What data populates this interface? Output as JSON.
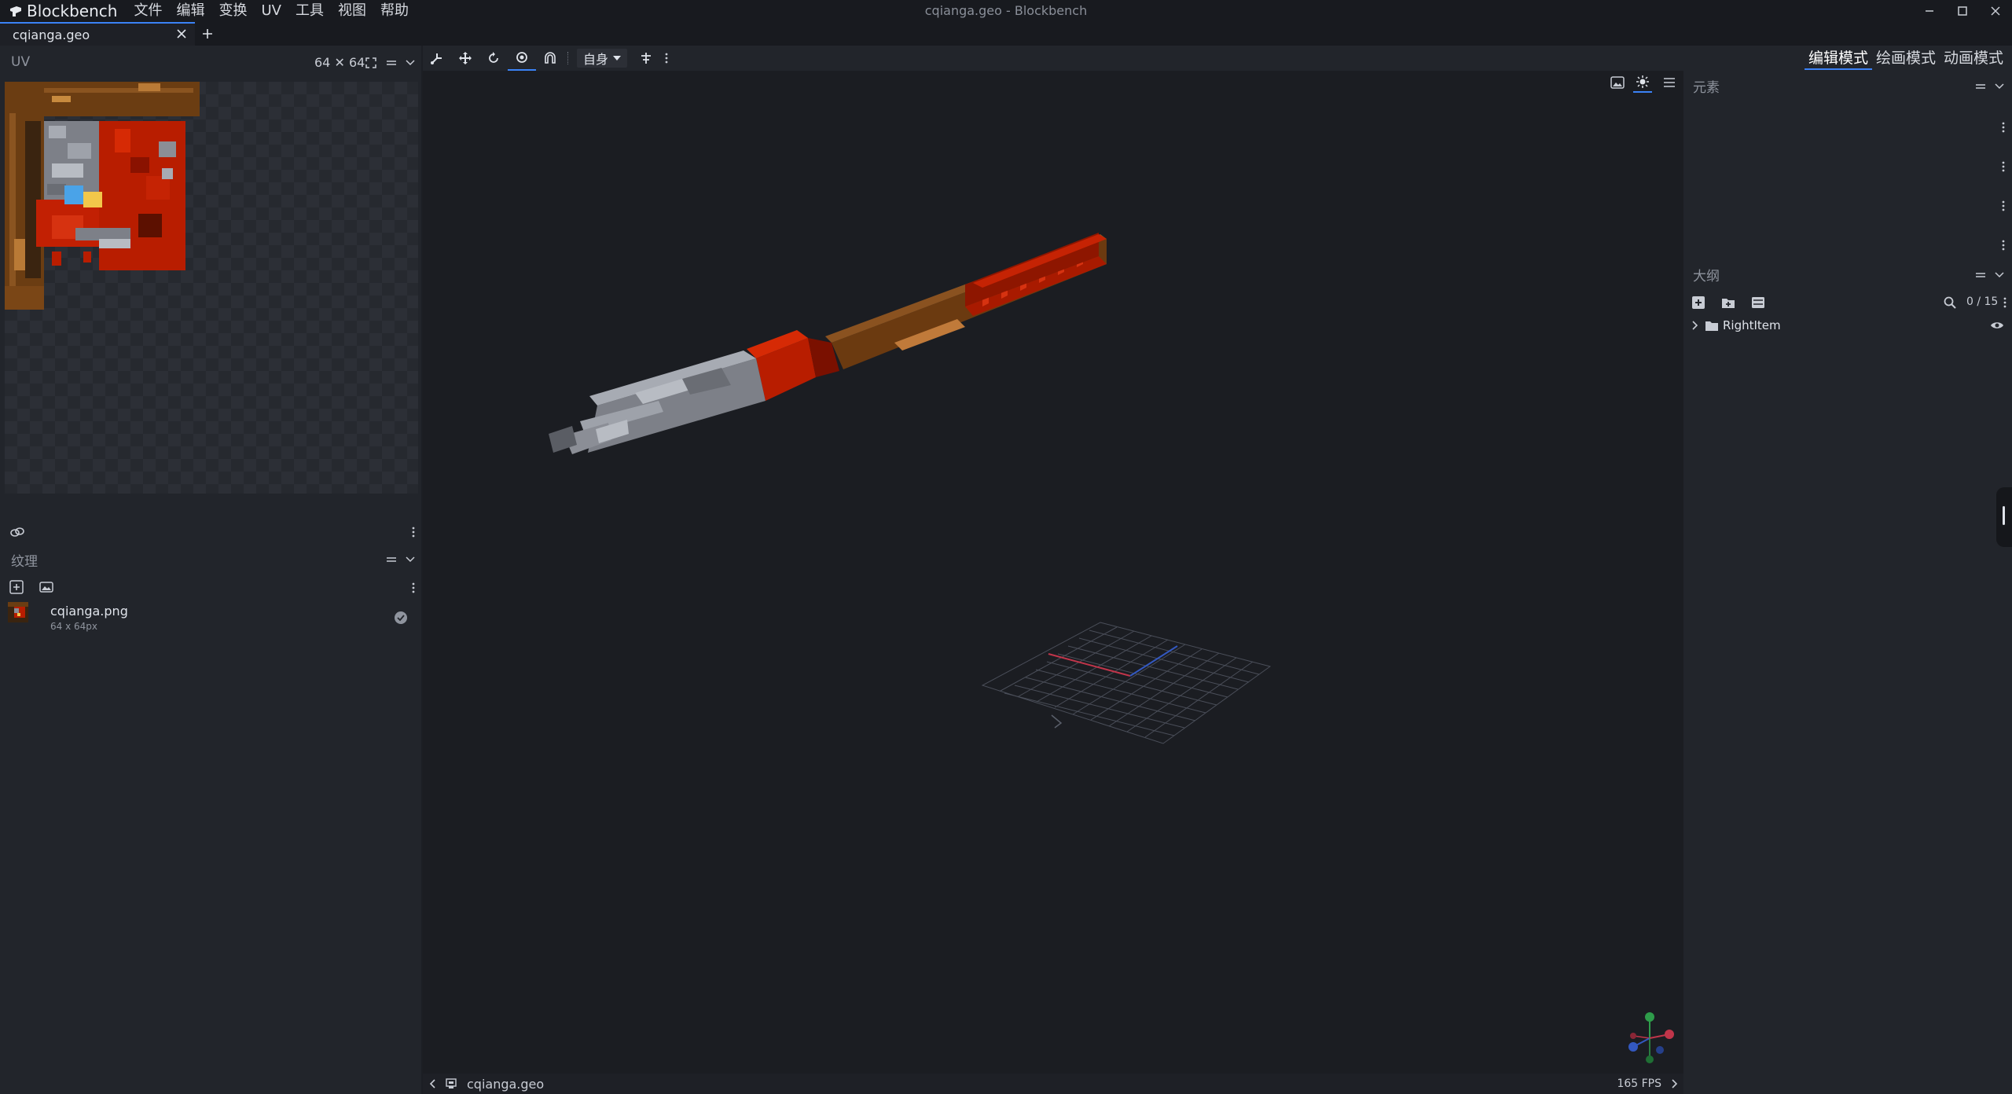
{
  "app": {
    "name": "Blockbench",
    "window_title": "cqianga.geo - Blockbench"
  },
  "menu": [
    "文件",
    "编辑",
    "变换",
    "UV",
    "工具",
    "视图",
    "帮助"
  ],
  "tabs": [
    {
      "label": "cqianga.geo"
    }
  ],
  "uv_panel": {
    "title": "UV",
    "size_label": "64 ✕ 64"
  },
  "texture_panel": {
    "title": "纹理",
    "items": [
      {
        "name": "cqianga.png",
        "size": "64 x 64px"
      }
    ]
  },
  "toolbar": {
    "space_dropdown": "自身"
  },
  "modes": [
    {
      "label": "编辑模式",
      "active": true
    },
    {
      "label": "绘画模式",
      "active": false
    },
    {
      "label": "动画模式",
      "active": false
    }
  ],
  "elements_panel": {
    "title": "元素"
  },
  "outliner_panel": {
    "title": "大纲",
    "count": "0 / 15",
    "items": [
      {
        "name": "RightItem",
        "type": "folder"
      }
    ]
  },
  "status": {
    "file": "cqianga.geo",
    "fps": "165 FPS"
  },
  "colors": {
    "accent": "#3b82f6",
    "background": "#1b1d22",
    "panel": "#22252b"
  }
}
